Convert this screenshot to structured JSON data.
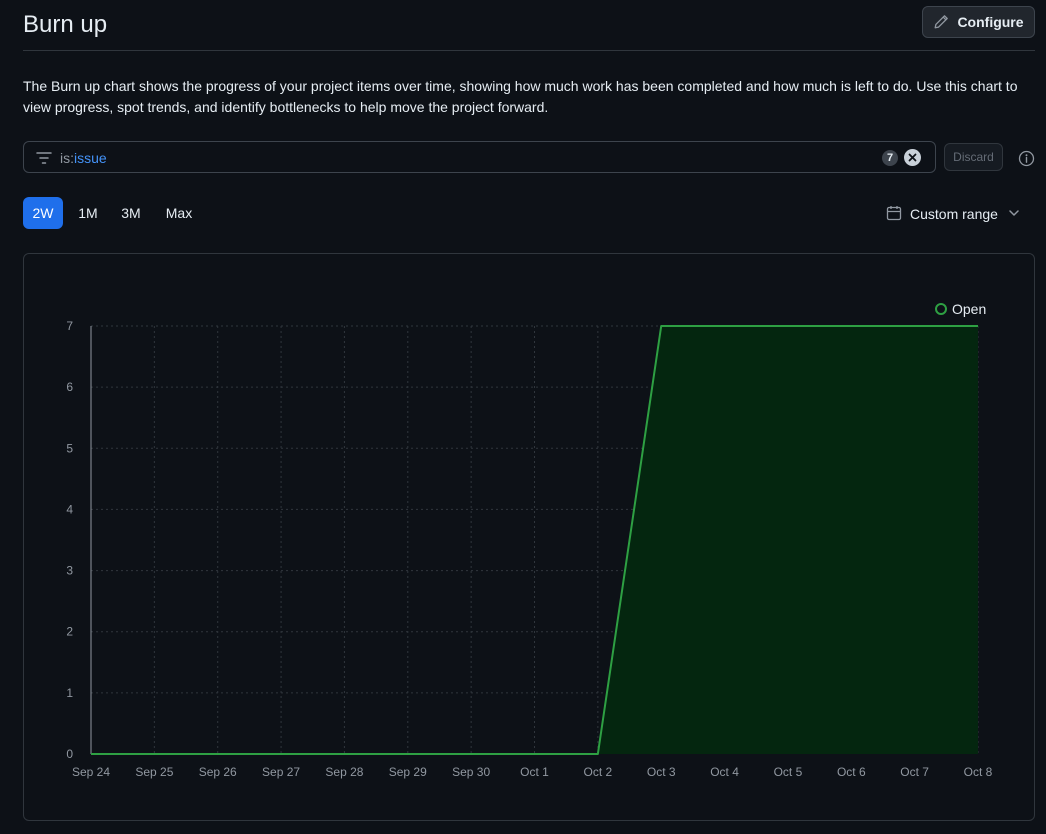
{
  "header": {
    "title": "Burn up",
    "configure_label": "Configure"
  },
  "description": "The Burn up chart shows the progress of your project items over time, showing how much work has been completed and how much is left to do. Use this chart to view progress, spot trends, and identify bottlenecks to help move the project forward.",
  "filter": {
    "key": "is:",
    "value": "issue",
    "count": "7",
    "discard_label": "Discard"
  },
  "range_tabs": [
    {
      "label": "2W",
      "active": true
    },
    {
      "label": "1M",
      "active": false
    },
    {
      "label": "3M",
      "active": false
    },
    {
      "label": "Max",
      "active": false
    }
  ],
  "custom_range_label": "Custom range",
  "icons": {
    "configure": "pencil-icon",
    "filter": "filter-icon",
    "clear": "x-circle-icon",
    "info": "info-icon",
    "calendar": "calendar-icon",
    "chevron": "chevron-down-icon"
  },
  "colors": {
    "accent": "#1f6feb",
    "series_open": "#2ea043",
    "series_fill": "#04260f"
  },
  "chart_data": {
    "type": "area",
    "x": [
      "Sep 24",
      "Sep 25",
      "Sep 26",
      "Sep 27",
      "Sep 28",
      "Sep 29",
      "Sep 30",
      "Oct 1",
      "Oct 2",
      "Oct 3",
      "Oct 4",
      "Oct 5",
      "Oct 6",
      "Oct 7",
      "Oct 8"
    ],
    "series": [
      {
        "name": "Open",
        "values": [
          0,
          0,
          0,
          0,
          0,
          0,
          0,
          0,
          0,
          7,
          7,
          7,
          7,
          7,
          7
        ]
      }
    ],
    "yticks": [
      0,
      1,
      2,
      3,
      4,
      5,
      6,
      7
    ],
    "ylim": [
      0,
      7
    ],
    "grid": true,
    "legend": "top-right"
  }
}
